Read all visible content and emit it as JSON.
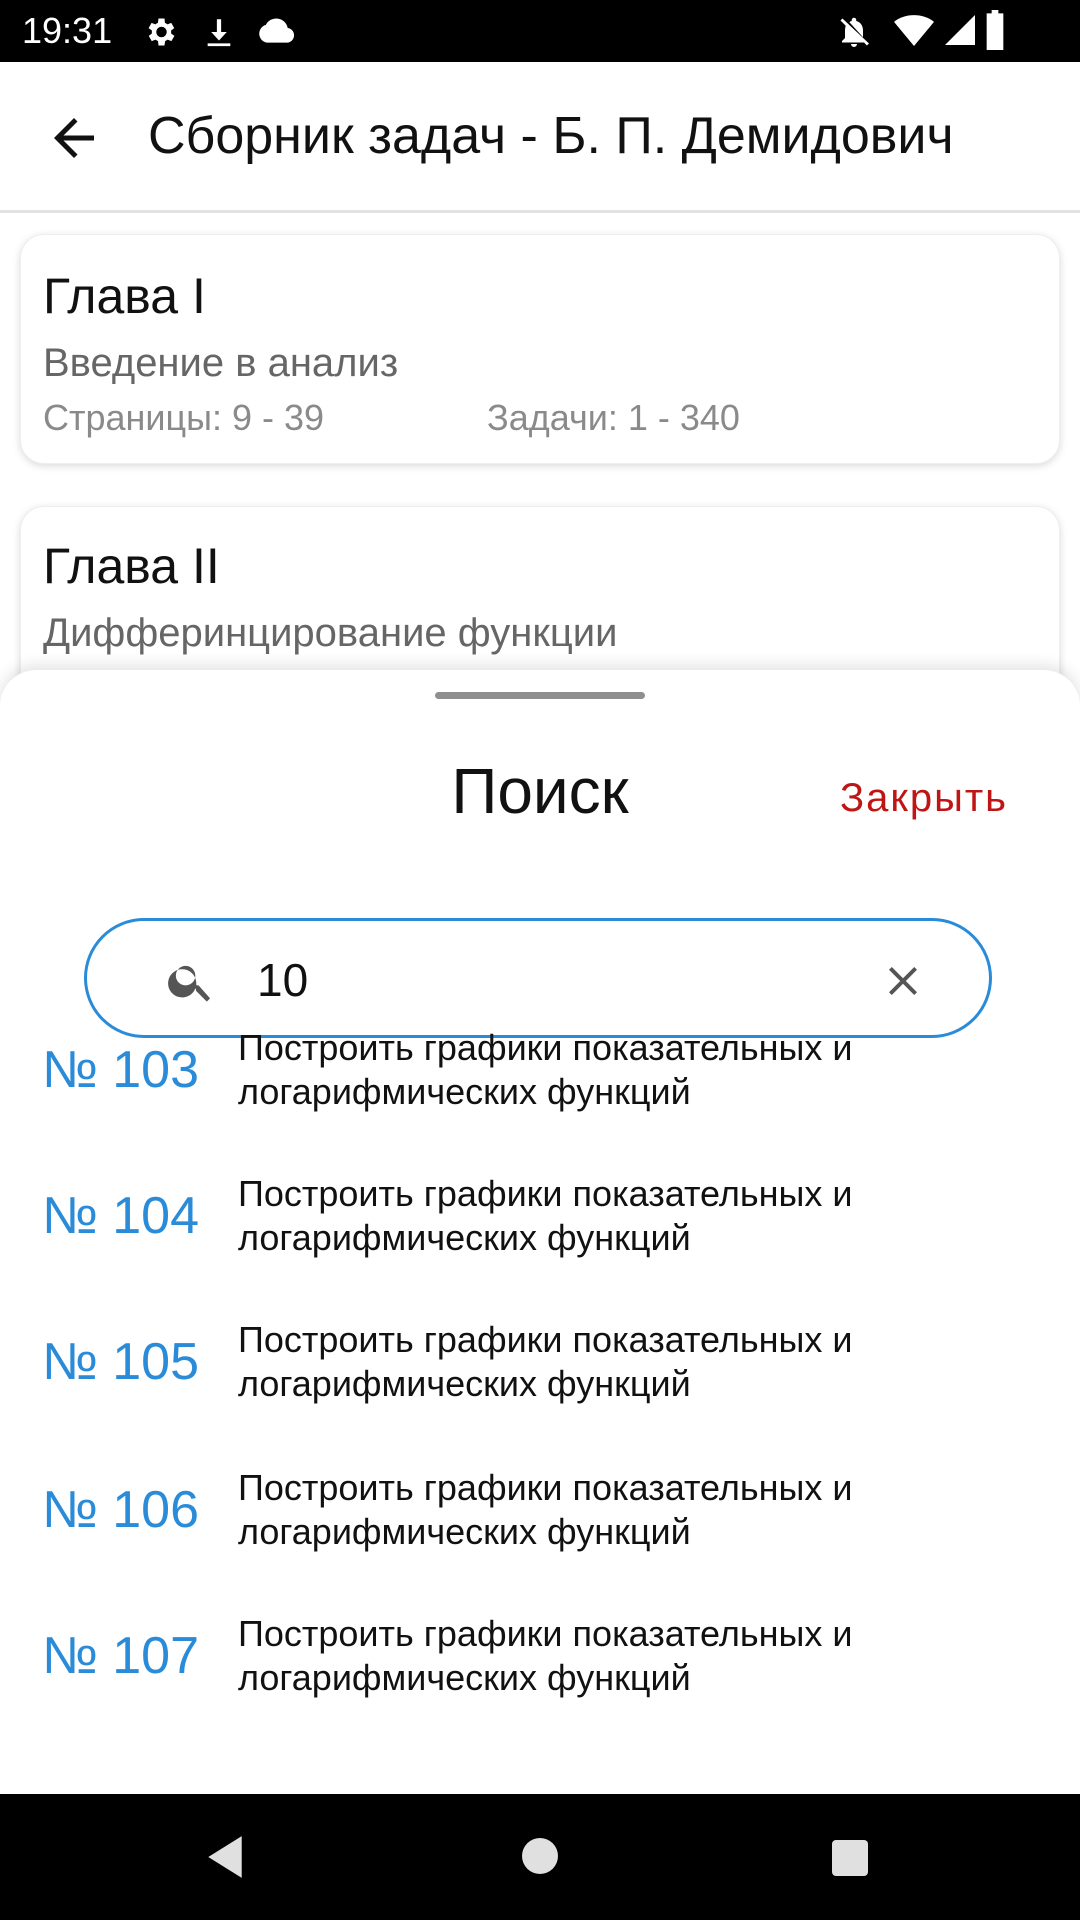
{
  "status_bar": {
    "time": "19:31"
  },
  "app_bar": {
    "title": "Сборник задач - Б. П. Демидович"
  },
  "chapters": [
    {
      "heading": "Глава I",
      "subtitle": "Введение в анализ",
      "pages": "Страницы: 9 - 39",
      "tasks": "Задачи: 1 - 340"
    },
    {
      "heading": "Глава II",
      "subtitle": "Дифферинцирование функции"
    }
  ],
  "search_sheet": {
    "title": "Поиск",
    "close_label": "Закрыть",
    "query": "10",
    "results": [
      {
        "number": "№ 103",
        "text": "Построить графики показательных и логарифмических функций"
      },
      {
        "number": "№ 104",
        "text": "Построить графики показательных и логарифмических функций"
      },
      {
        "number": "№ 105",
        "text": "Построить графики показательных и логарифмических функций"
      },
      {
        "number": "№ 106",
        "text": "Построить графики показательных и логарифмических функций"
      },
      {
        "number": "№ 107",
        "text": "Построить графики показательных и логарифмических функций"
      }
    ]
  },
  "colors": {
    "accent": "#2a8bd8",
    "close": "#c01515"
  }
}
